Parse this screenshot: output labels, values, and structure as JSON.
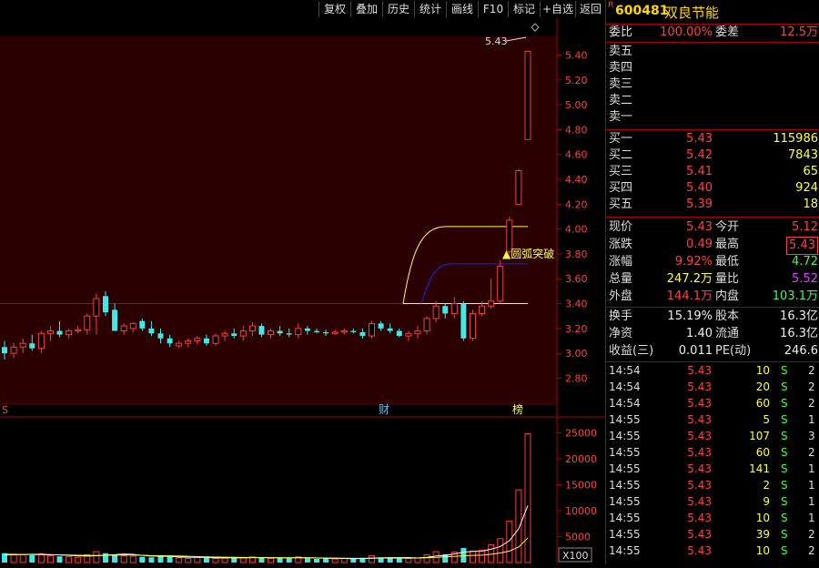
{
  "toolbar": {
    "buttons": [
      "复权",
      "叠加",
      "历史",
      "统计",
      "画线",
      "F10",
      "标记",
      "+自选",
      "返回"
    ]
  },
  "stock": {
    "code": "600481",
    "name": "双良节能",
    "marker": "R"
  },
  "quote": {
    "weibi_label": "委比",
    "weibi": "100.00%",
    "weicha_label": "委差",
    "weicha": "12.5万",
    "sell": [
      {
        "label": "卖五"
      },
      {
        "label": "卖四"
      },
      {
        "label": "卖三"
      },
      {
        "label": "卖二"
      },
      {
        "label": "卖一"
      }
    ],
    "buy": [
      {
        "label": "买一",
        "price": "5.43",
        "vol": "115986"
      },
      {
        "label": "买二",
        "price": "5.42",
        "vol": "7843"
      },
      {
        "label": "买三",
        "price": "5.41",
        "vol": "65"
      },
      {
        "label": "买四",
        "price": "5.40",
        "vol": "924"
      },
      {
        "label": "买五",
        "price": "5.39",
        "vol": "18"
      }
    ],
    "stats": [
      {
        "l1": "现价",
        "v1": "5.43",
        "l2": "今开",
        "v2": "5.12"
      },
      {
        "l1": "涨跌",
        "v1": "0.49",
        "l2": "最高",
        "v2": "5.43"
      },
      {
        "l1": "涨幅",
        "v1": "9.92%",
        "l2": "最低",
        "v2": "4.72"
      },
      {
        "l1": "总量",
        "v1": "247.2万",
        "l2": "量比",
        "v2": "5.52"
      },
      {
        "l1": "外盘",
        "v1": "144.1万",
        "l2": "内盘",
        "v2": "103.1万"
      }
    ],
    "fin": [
      {
        "l1": "换手",
        "v1": "15.19%",
        "l2": "股本",
        "v2": "16.3亿"
      },
      {
        "l1": "净资",
        "v1": "1.40",
        "l2": "流通",
        "v2": "16.3亿"
      },
      {
        "l1": "收益(三)",
        "v1": "0.011",
        "l2": "PE(动)",
        "v2": "246.6"
      }
    ]
  },
  "ticks": [
    {
      "time": "14:54",
      "price": "5.43",
      "vol": "10",
      "side": "S",
      "n": "2"
    },
    {
      "time": "14:54",
      "price": "5.43",
      "vol": "20",
      "side": "S",
      "n": "2"
    },
    {
      "time": "14:54",
      "price": "5.43",
      "vol": "60",
      "side": "S",
      "n": "2"
    },
    {
      "time": "14:55",
      "price": "5.43",
      "vol": "5",
      "side": "S",
      "n": "1"
    },
    {
      "time": "14:55",
      "price": "5.43",
      "vol": "107",
      "side": "S",
      "n": "3"
    },
    {
      "time": "14:55",
      "price": "5.43",
      "vol": "60",
      "side": "S",
      "n": "2"
    },
    {
      "time": "14:55",
      "price": "5.43",
      "vol": "141",
      "side": "S",
      "n": "1"
    },
    {
      "time": "14:55",
      "price": "5.43",
      "vol": "2",
      "side": "S",
      "n": "1"
    },
    {
      "time": "14:55",
      "price": "5.43",
      "vol": "9",
      "side": "S",
      "n": "1"
    },
    {
      "time": "14:55",
      "price": "5.43",
      "vol": "10",
      "side": "S",
      "n": "1"
    },
    {
      "time": "14:55",
      "price": "5.43",
      "vol": "39",
      "side": "S",
      "n": "2"
    },
    {
      "time": "14:55",
      "price": "5.43",
      "vol": "10",
      "side": "S",
      "n": "2"
    }
  ],
  "chart_data": {
    "type": "candlestick",
    "price_axis": {
      "ticks": [
        "5.40",
        "5.20",
        "5.00",
        "4.80",
        "4.60",
        "4.40",
        "4.20",
        "4.00",
        "3.80",
        "3.60",
        "3.40",
        "3.20",
        "3.00",
        "2.80"
      ],
      "range": [
        2.62,
        5.55
      ]
    },
    "volume_axis": {
      "ticks": [
        "25000",
        "20000",
        "15000",
        "10000",
        "5000"
      ],
      "range": [
        0,
        27000
      ],
      "unit_label": "X100"
    },
    "annotations": {
      "peak_label": "5.43",
      "signal_label": "▲圆弧突破",
      "finance_marker": "财",
      "rank_marker": "榜",
      "s_marker": "S"
    },
    "colors": {
      "up": "#ff3c3c",
      "down": "#40e8e8",
      "blue_line": "#2020ff",
      "yellow_line": "#ffff40",
      "bg_tint": "#2a0000"
    },
    "candles": [
      [
        3.05,
        3.1,
        2.95,
        3.0
      ],
      [
        3.0,
        3.08,
        2.96,
        3.05
      ],
      [
        3.05,
        3.12,
        3.0,
        3.08
      ],
      [
        3.08,
        3.15,
        3.02,
        3.04
      ],
      [
        3.04,
        3.18,
        3.0,
        3.16
      ],
      [
        3.16,
        3.22,
        3.1,
        3.18
      ],
      [
        3.18,
        3.26,
        3.13,
        3.15
      ],
      [
        3.15,
        3.2,
        3.12,
        3.18
      ],
      [
        3.18,
        3.22,
        3.16,
        3.19
      ],
      [
        3.19,
        3.32,
        3.15,
        3.3
      ],
      [
        3.3,
        3.48,
        3.15,
        3.44
      ],
      [
        3.46,
        3.5,
        3.3,
        3.33
      ],
      [
        3.35,
        3.4,
        3.2,
        3.18
      ],
      [
        3.18,
        3.24,
        3.15,
        3.22
      ],
      [
        3.2,
        3.25,
        3.17,
        3.24
      ],
      [
        3.26,
        3.28,
        3.18,
        3.2
      ],
      [
        3.2,
        3.26,
        3.14,
        3.16
      ],
      [
        3.16,
        3.2,
        3.08,
        3.12
      ],
      [
        3.12,
        3.15,
        3.05,
        3.08
      ],
      [
        3.06,
        3.1,
        3.04,
        3.08
      ],
      [
        3.08,
        3.12,
        3.05,
        3.1
      ],
      [
        3.1,
        3.14,
        3.07,
        3.12
      ],
      [
        3.12,
        3.15,
        3.06,
        3.08
      ],
      [
        3.08,
        3.16,
        3.06,
        3.14
      ],
      [
        3.14,
        3.18,
        3.1,
        3.16
      ],
      [
        3.16,
        3.2,
        3.12,
        3.14
      ],
      [
        3.14,
        3.22,
        3.1,
        3.18
      ],
      [
        3.18,
        3.25,
        3.14,
        3.22
      ],
      [
        3.22,
        3.24,
        3.13,
        3.15
      ],
      [
        3.15,
        3.2,
        3.12,
        3.18
      ],
      [
        3.18,
        3.22,
        3.14,
        3.16
      ],
      [
        3.16,
        3.2,
        3.13,
        3.15
      ],
      [
        3.15,
        3.24,
        3.12,
        3.2
      ],
      [
        3.2,
        3.22,
        3.15,
        3.18
      ],
      [
        3.18,
        3.2,
        3.16,
        3.17
      ],
      [
        3.17,
        3.19,
        3.14,
        3.16
      ],
      [
        3.16,
        3.19,
        3.15,
        3.17
      ],
      [
        3.17,
        3.2,
        3.15,
        3.18
      ],
      [
        3.18,
        3.2,
        3.16,
        3.17
      ],
      [
        3.17,
        3.2,
        3.12,
        3.14
      ],
      [
        3.14,
        3.26,
        3.12,
        3.24
      ],
      [
        3.24,
        3.26,
        3.18,
        3.2
      ],
      [
        3.2,
        3.24,
        3.16,
        3.18
      ],
      [
        3.18,
        3.2,
        3.13,
        3.14
      ],
      [
        3.14,
        3.18,
        3.1,
        3.16
      ],
      [
        3.16,
        3.22,
        3.12,
        3.18
      ],
      [
        3.18,
        3.3,
        3.15,
        3.28
      ],
      [
        3.28,
        3.42,
        3.25,
        3.38
      ],
      [
        3.38,
        3.4,
        3.28,
        3.32
      ],
      [
        3.32,
        3.45,
        3.28,
        3.4
      ],
      [
        3.4,
        3.42,
        3.1,
        3.12
      ],
      [
        3.12,
        3.35,
        3.1,
        3.32
      ],
      [
        3.32,
        3.42,
        3.3,
        3.38
      ],
      [
        3.38,
        3.6,
        3.36,
        3.42
      ],
      [
        3.42,
        3.75,
        3.4,
        3.7
      ],
      [
        3.82,
        4.1,
        3.8,
        4.07
      ],
      [
        4.2,
        4.48,
        4.2,
        4.47
      ],
      [
        4.72,
        5.43,
        4.72,
        5.43
      ]
    ],
    "volumes": [
      1800,
      1600,
      1500,
      1400,
      1700,
      1300,
      1200,
      1100,
      1000,
      1500,
      2100,
      1800,
      1500,
      1300,
      1200,
      1100,
      1000,
      1300,
      1100,
      900,
      800,
      1000,
      900,
      800,
      900,
      1000,
      900,
      1100,
      1000,
      800,
      900,
      800,
      1100,
      800,
      700,
      800,
      700,
      800,
      700,
      900,
      1300,
      1000,
      900,
      800,
      800,
      900,
      1500,
      2100,
      1600,
      2000,
      2800,
      2200,
      2400,
      3400,
      4600,
      8000,
      14000,
      24800
    ],
    "ma5": [
      1500,
      1500,
      1550,
      1600,
      1580,
      1540,
      1460,
      1380,
      1300,
      1240,
      1320,
      1420,
      1520,
      1640,
      1580,
      1380,
      1260,
      1220,
      1180,
      1080,
      1020,
      1000,
      980,
      900,
      880,
      920,
      900,
      940,
      960,
      940,
      920,
      900,
      940,
      920,
      880,
      840,
      780,
      780,
      740,
      760,
      860,
      900,
      940,
      940,
      960,
      880,
      1000,
      1260,
      1380,
      1640,
      2000,
      2140,
      2200,
      2560,
      3080,
      4200,
      6480,
      10960
    ],
    "ma10": [
      1600,
      1580,
      1560,
      1540,
      1520,
      1500,
      1480,
      1440,
      1400,
      1370,
      1360,
      1380,
      1420,
      1470,
      1450,
      1400,
      1340,
      1320,
      1300,
      1250,
      1200,
      1130,
      1090,
      1060,
      1030,
      1010,
      990,
      970,
      950,
      930,
      920,
      910,
      920,
      910,
      900,
      880,
      860,
      840,
      820,
      800,
      810,
      850,
      860,
      860,
      860,
      870,
      930,
      1000,
      1090,
      1180,
      1300,
      1380,
      1430,
      1610,
      1840,
      2220,
      2990,
      4720
    ]
  }
}
